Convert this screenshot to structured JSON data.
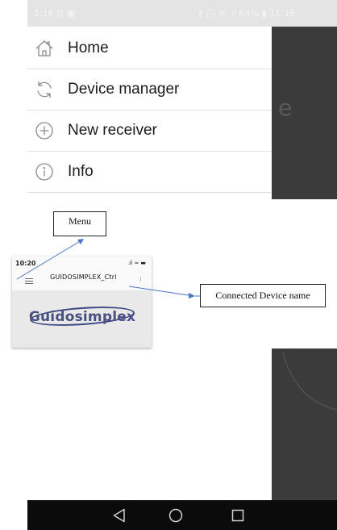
{
  "status_bar": {
    "left_text": "1:16 ⊠ ▣",
    "right_text": "∦ ◯ ⊘ .ıl 64% ▮ 11:16"
  },
  "drawer": {
    "items": [
      {
        "label": "Home",
        "icon": "home-icon"
      },
      {
        "label": "Device manager",
        "icon": "refresh-icon"
      },
      {
        "label": "New receiver",
        "icon": "plus-circle-icon"
      },
      {
        "label": "Info",
        "icon": "info-icon"
      }
    ]
  },
  "background_hint": "e",
  "annotations": {
    "menu": "Menu",
    "device_name": "Connected Device name"
  },
  "mockup": {
    "time": "10:20",
    "signal": ".ıl ≈ ▬",
    "device_name": "GUIDOSIMPLEX_Ctrl",
    "logo": "Guidosimplex"
  },
  "nav_bar": {
    "buttons": [
      "back-icon",
      "home-circle-icon",
      "recents-icon"
    ]
  },
  "colors": {
    "scrim": "#3b3b3b",
    "nav_bar": "#0b0b0b",
    "logo": "#3b4580"
  }
}
